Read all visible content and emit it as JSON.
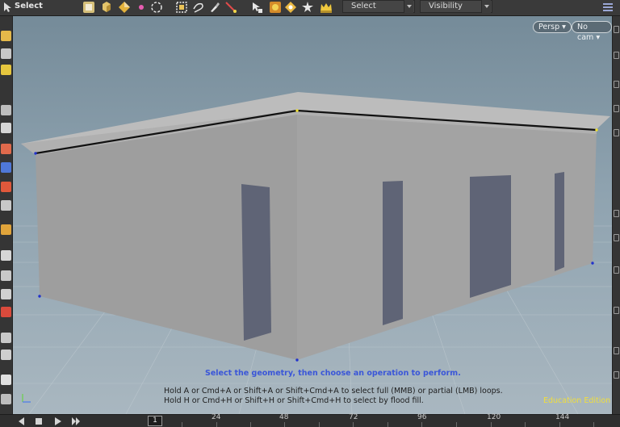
{
  "toolbar": {
    "title": "Select",
    "select_dropdown": "Select",
    "visibility_dropdown": "Visibility",
    "icons": [
      "select-mode-icon",
      "object-icon",
      "primitive-icon",
      "point-icon",
      "lasso-icon",
      "box-select-icon",
      "brush-select-icon",
      "paint-select-icon",
      "laser-select-icon",
      "pick-icon",
      "group-icon",
      "pose-icon",
      "crown-icon"
    ]
  },
  "viewport": {
    "persp_button": "Persp",
    "cam_button": "No cam",
    "prompt": "Select the geometry, then choose an operation to perform.",
    "hint_line1": "Hold A or Cmd+A or Shift+A or Shift+Cmd+A to select full (MMB) or partial (LMB) loops.",
    "hint_line2": "Hold H or Cmd+H or Shift+H or Shift+Cmd+H to select by flood fill.",
    "watermark": "Education Edition",
    "axis_y": "Y",
    "axis_x": "Z"
  },
  "timeline": {
    "current_frame": "1",
    "ticks": [
      "24",
      "48",
      "72",
      "96",
      "120",
      "144"
    ]
  },
  "colors": {
    "accent_blue": "#3a56d8",
    "watermark_yellow": "#f1df3c",
    "selected_edge": "#111111"
  }
}
